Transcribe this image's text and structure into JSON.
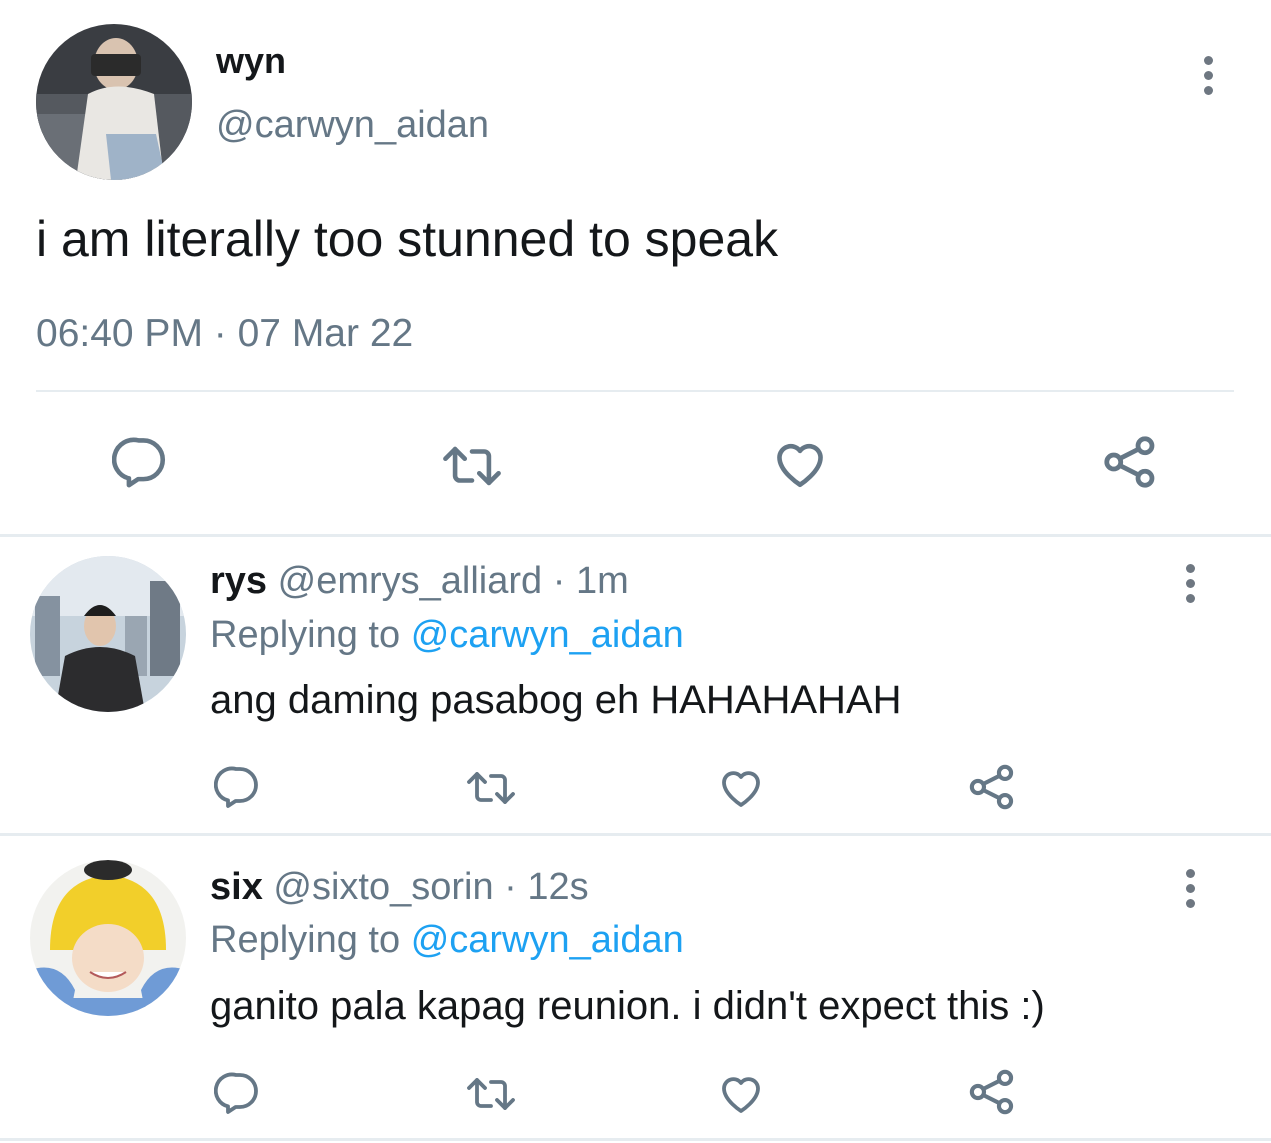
{
  "main_tweet": {
    "display_name": "wyn",
    "handle": "@carwyn_aidan",
    "text": "i am literally too stunned to speak",
    "time": "06:40 PM",
    "date_separator": " · ",
    "date": "07 Mar 22",
    "actions": [
      "reply-icon",
      "retweet-icon",
      "like-icon",
      "share-icon"
    ]
  },
  "replies": [
    {
      "display_name": "rys",
      "handle": "@emrys_alliard",
      "time_separator": " · ",
      "time": "1m",
      "replying_label": "Replying to",
      "replying_handle": "@carwyn_aidan",
      "text": "ang daming pasabog eh HAHAHAHAH"
    },
    {
      "display_name": "six",
      "handle": "@sixto_sorin",
      "time_separator": " · ",
      "time": "12s",
      "replying_label": "Replying to",
      "replying_handle": "@carwyn_aidan",
      "text": "ganito pala kapag reunion. i didn't expect this :)"
    }
  ],
  "colors": {
    "text": "#14171a",
    "muted": "#657786",
    "link": "#1da1f2",
    "divider": "#e6ecf0"
  }
}
